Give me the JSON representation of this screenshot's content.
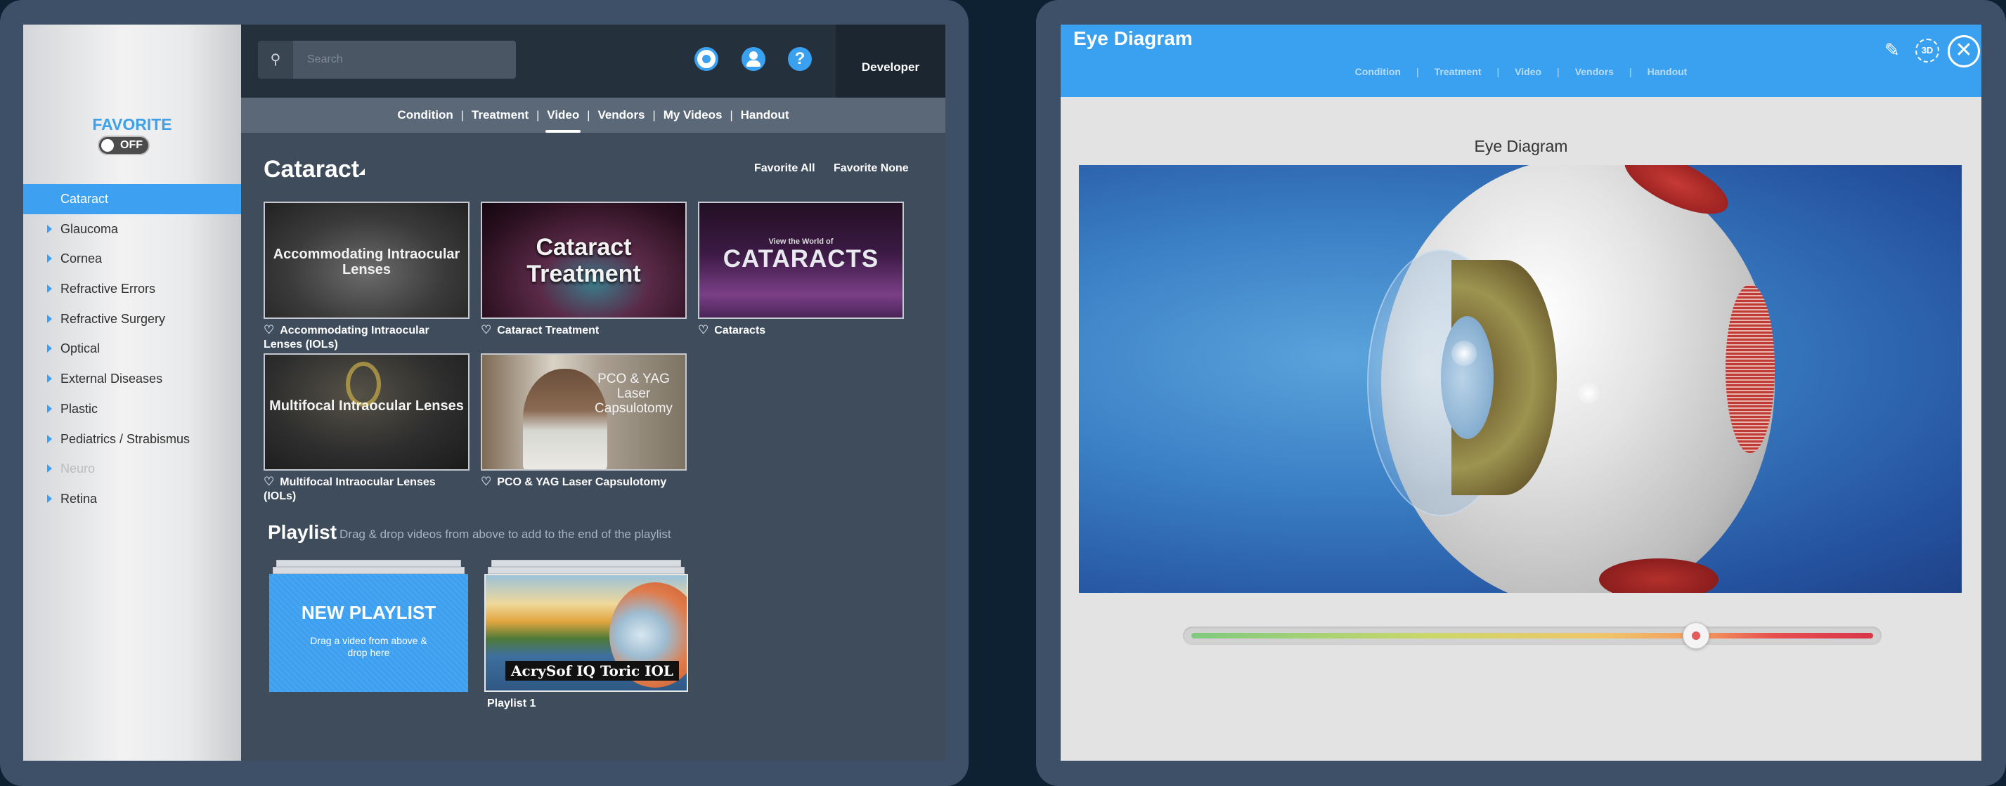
{
  "left_app": {
    "sidebar": {
      "favorite_label": "FAVORITE",
      "favorite_toggle": "OFF",
      "items": [
        {
          "label": "Cataract",
          "state": "active"
        },
        {
          "label": "Glaucoma",
          "state": "normal"
        },
        {
          "label": "Cornea",
          "state": "normal"
        },
        {
          "label": "Refractive Errors",
          "state": "normal"
        },
        {
          "label": "Refractive Surgery",
          "state": "normal"
        },
        {
          "label": "Optical",
          "state": "normal"
        },
        {
          "label": "External Diseases",
          "state": "normal"
        },
        {
          "label": "Plastic",
          "state": "normal"
        },
        {
          "label": "Pediatrics / Strabismus",
          "state": "normal"
        },
        {
          "label": "Neuro",
          "state": "disabled"
        },
        {
          "label": "Retina",
          "state": "normal"
        }
      ]
    },
    "topbar": {
      "search_placeholder": "Search",
      "search_icon": "search-icon",
      "refresh_icon": "refresh-icon",
      "user_icon": "user-icon",
      "help_symbol": "?",
      "developer_label": "Developer"
    },
    "tabs": [
      {
        "label": "Condition",
        "active": false
      },
      {
        "label": "Treatment",
        "active": false
      },
      {
        "label": "Video",
        "active": true
      },
      {
        "label": "Vendors",
        "active": false
      },
      {
        "label": "My Videos",
        "active": false
      },
      {
        "label": "Handout",
        "active": false
      }
    ],
    "section_title": "Cataract",
    "favorite_all": "Favorite All",
    "favorite_none": "Favorite None",
    "videos": [
      {
        "caption": "Accommodating Intraocular Lenses (IOLs)",
        "thumb_text": "Accommodating Intraocular Lenses"
      },
      {
        "caption": "Cataract Treatment",
        "thumb_text": "Cataract Treatment"
      },
      {
        "caption": "Cataracts",
        "thumb_small": "View the World of",
        "thumb_text": "CATARACTS"
      },
      {
        "caption": "Multifocal Intraocular Lenses (IOLs)",
        "thumb_text": "Multifocal Intraocular Lenses"
      },
      {
        "caption": "PCO & YAG Laser Capsulotomy",
        "thumb_text": "PCO & YAG Laser Capsulotomy"
      }
    ],
    "heart_symbol": "♡",
    "playlist": {
      "title": "Playlist",
      "hint": "Drag & drop videos from above to add to the end of the playlist",
      "new_title": "NEW PLAYLIST",
      "new_subtitle": "Drag a video from above & drop here",
      "playlist_1_banner": "AcrySof IQ Toric IOL",
      "playlist_1_caption": "Playlist 1"
    }
  },
  "right_app": {
    "title": "Eye Diagram",
    "tabs": [
      "Condition",
      "Treatment",
      "Video",
      "Vendors",
      "Handout"
    ],
    "pencil_symbol": "✎",
    "threed_label": "3D",
    "close_symbol": "✕",
    "diagram_caption": "Eye Diagram",
    "slider_value_fraction": 0.74
  },
  "colors": {
    "accent_blue": "#3aa0f0",
    "sidebar_active": "#3ea0f0",
    "main_bg": "#3f4c5c",
    "topbar_bg": "#25303d"
  }
}
